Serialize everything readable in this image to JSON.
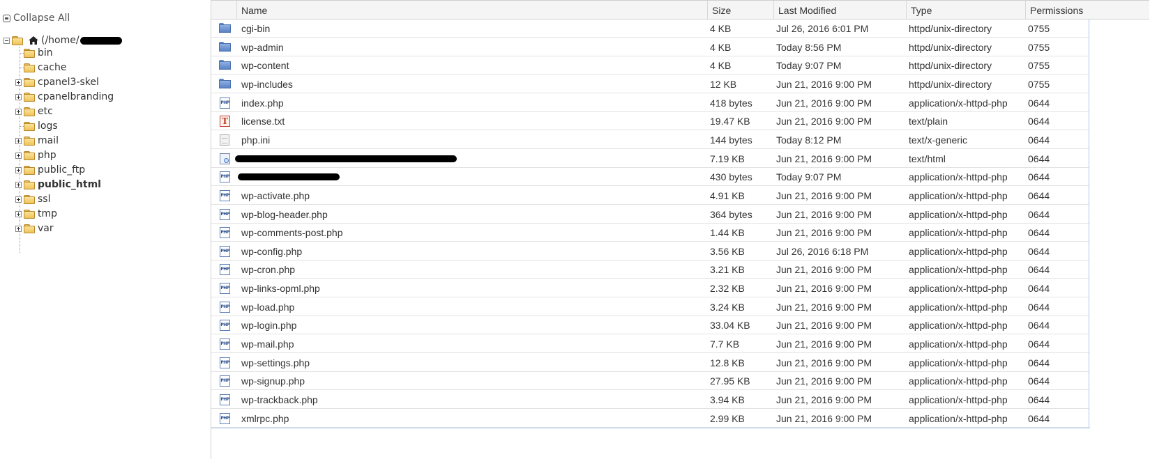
{
  "tree": {
    "collapse_all_label": "Collapse All",
    "root_label": "(/home/",
    "items": [
      {
        "label": "bin",
        "expandable": false,
        "bold": false
      },
      {
        "label": "cache",
        "expandable": false,
        "bold": false
      },
      {
        "label": "cpanel3-skel",
        "expandable": true,
        "bold": false
      },
      {
        "label": "cpanelbranding",
        "expandable": true,
        "bold": false
      },
      {
        "label": "etc",
        "expandable": true,
        "bold": false
      },
      {
        "label": "logs",
        "expandable": false,
        "bold": false
      },
      {
        "label": "mail",
        "expandable": true,
        "bold": false
      },
      {
        "label": "php",
        "expandable": true,
        "bold": false
      },
      {
        "label": "public_ftp",
        "expandable": true,
        "bold": false
      },
      {
        "label": "public_html",
        "expandable": true,
        "bold": true
      },
      {
        "label": "ssl",
        "expandable": true,
        "bold": false
      },
      {
        "label": "tmp",
        "expandable": true,
        "bold": false
      },
      {
        "label": "var",
        "expandable": true,
        "bold": false
      }
    ]
  },
  "table": {
    "headers": {
      "name": "Name",
      "size": "Size",
      "modified": "Last Modified",
      "type": "Type",
      "permissions": "Permissions"
    },
    "rows": [
      {
        "icon": "folder-icon",
        "name": "cgi-bin",
        "size": "4 KB",
        "modified": "Jul 26, 2016 6:01 PM",
        "type": "httpd/unix-directory",
        "perm": "0755"
      },
      {
        "icon": "folder-icon",
        "name": "wp-admin",
        "size": "4 KB",
        "modified": "Today 8:56 PM",
        "type": "httpd/unix-directory",
        "perm": "0755"
      },
      {
        "icon": "folder-icon",
        "name": "wp-content",
        "size": "4 KB",
        "modified": "Today 9:07 PM",
        "type": "httpd/unix-directory",
        "perm": "0755"
      },
      {
        "icon": "folder-icon",
        "name": "wp-includes",
        "size": "12 KB",
        "modified": "Jun 21, 2016 9:00 PM",
        "type": "httpd/unix-directory",
        "perm": "0755"
      },
      {
        "icon": "php-file-icon",
        "name": "index.php",
        "size": "418 bytes",
        "modified": "Jun 21, 2016 9:00 PM",
        "type": "application/x-httpd-php",
        "perm": "0644"
      },
      {
        "icon": "text-file-icon",
        "name": "license.txt",
        "size": "19.47 KB",
        "modified": "Jun 21, 2016 9:00 PM",
        "type": "text/plain",
        "perm": "0644"
      },
      {
        "icon": "generic-file-icon",
        "name": "php.ini",
        "size": "144 bytes",
        "modified": "Today 8:12 PM",
        "type": "text/x-generic",
        "perm": "0644"
      },
      {
        "icon": "html-file-icon",
        "name": "",
        "redacted": true,
        "size": "7.19 KB",
        "modified": "Jun 21, 2016 9:00 PM",
        "type": "text/html",
        "perm": "0644"
      },
      {
        "icon": "php-file-icon",
        "name": "",
        "redacted": true,
        "size": "430 bytes",
        "modified": "Today 9:07 PM",
        "type": "application/x-httpd-php",
        "perm": "0644"
      },
      {
        "icon": "php-file-icon",
        "name": "wp-activate.php",
        "size": "4.91 KB",
        "modified": "Jun 21, 2016 9:00 PM",
        "type": "application/x-httpd-php",
        "perm": "0644"
      },
      {
        "icon": "php-file-icon",
        "name": "wp-blog-header.php",
        "size": "364 bytes",
        "modified": "Jun 21, 2016 9:00 PM",
        "type": "application/x-httpd-php",
        "perm": "0644"
      },
      {
        "icon": "php-file-icon",
        "name": "wp-comments-post.php",
        "size": "1.44 KB",
        "modified": "Jun 21, 2016 9:00 PM",
        "type": "application/x-httpd-php",
        "perm": "0644"
      },
      {
        "icon": "php-file-icon",
        "name": "wp-config.php",
        "size": "3.56 KB",
        "modified": "Jul 26, 2016 6:18 PM",
        "type": "application/x-httpd-php",
        "perm": "0644"
      },
      {
        "icon": "php-file-icon",
        "name": "wp-cron.php",
        "size": "3.21 KB",
        "modified": "Jun 21, 2016 9:00 PM",
        "type": "application/x-httpd-php",
        "perm": "0644"
      },
      {
        "icon": "php-file-icon",
        "name": "wp-links-opml.php",
        "size": "2.32 KB",
        "modified": "Jun 21, 2016 9:00 PM",
        "type": "application/x-httpd-php",
        "perm": "0644"
      },
      {
        "icon": "php-file-icon",
        "name": "wp-load.php",
        "size": "3.24 KB",
        "modified": "Jun 21, 2016 9:00 PM",
        "type": "application/x-httpd-php",
        "perm": "0644"
      },
      {
        "icon": "php-file-icon",
        "name": "wp-login.php",
        "size": "33.04 KB",
        "modified": "Jun 21, 2016 9:00 PM",
        "type": "application/x-httpd-php",
        "perm": "0644"
      },
      {
        "icon": "php-file-icon",
        "name": "wp-mail.php",
        "size": "7.7 KB",
        "modified": "Jun 21, 2016 9:00 PM",
        "type": "application/x-httpd-php",
        "perm": "0644"
      },
      {
        "icon": "php-file-icon",
        "name": "wp-settings.php",
        "size": "12.8 KB",
        "modified": "Jun 21, 2016 9:00 PM",
        "type": "application/x-httpd-php",
        "perm": "0644"
      },
      {
        "icon": "php-file-icon",
        "name": "wp-signup.php",
        "size": "27.95 KB",
        "modified": "Jun 21, 2016 9:00 PM",
        "type": "application/x-httpd-php",
        "perm": "0644"
      },
      {
        "icon": "php-file-icon",
        "name": "wp-trackback.php",
        "size": "3.94 KB",
        "modified": "Jun 21, 2016 9:00 PM",
        "type": "application/x-httpd-php",
        "perm": "0644"
      },
      {
        "icon": "php-file-icon",
        "name": "xmlrpc.php",
        "size": "2.99 KB",
        "modified": "Jun 21, 2016 9:00 PM",
        "type": "application/x-httpd-php",
        "perm": "0644"
      }
    ]
  },
  "colors": {
    "selection_border": "#a9c6ea",
    "header_bg": "#f5f5f5",
    "folder_yellow": "#eec35a",
    "folder_blue": "#5a83c4"
  }
}
